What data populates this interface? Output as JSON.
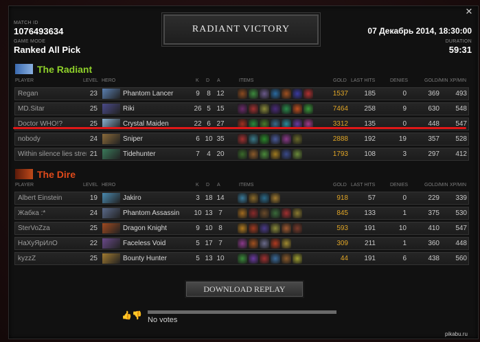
{
  "header": {
    "match_id_label": "MATCH ID",
    "match_id": "1076493634",
    "game_mode_label": "GAME MODE",
    "game_mode": "Ranked All Pick",
    "result_title": "RADIANT VICTORY",
    "date": "07 Декабрь 2014, 18:30:00",
    "duration_label": "DURATION",
    "duration": "59:31",
    "close_icon": "✕"
  },
  "columns": {
    "player": "PLAYER",
    "level": "LEVEL",
    "hero": "HERO",
    "k": "K",
    "d": "D",
    "a": "A",
    "items": "ITEMS",
    "gold": "GOLD",
    "last_hits": "LAST HITS",
    "denies": "DENIES",
    "gold_min": "GOLD/MIN",
    "xp_min": "XP/MIN"
  },
  "radiant": {
    "name": "The Radiant",
    "color": "#8fd12a",
    "players": [
      {
        "player": "Regan",
        "level": "23",
        "hero": "Phantom Lancer",
        "k": "9",
        "d": "8",
        "a": "12",
        "gold": "1537",
        "lh": "185",
        "den": "0",
        "gpm": "369",
        "xpm": "493",
        "hero_color": "#5a7fb0",
        "items": [
          "#8a4a20",
          "#3d8a3d",
          "#6a5a8a",
          "#2a6aa0",
          "#a05020",
          "#3a3aa0",
          "#b03030"
        ]
      },
      {
        "player": "MD.Sitar",
        "level": "25",
        "hero": "Riki",
        "k": "26",
        "d": "5",
        "a": "15",
        "gold": "7464",
        "lh": "258",
        "den": "9",
        "gpm": "630",
        "xpm": "548",
        "hero_color": "#4a4a8a",
        "items": [
          "#6a2a6a",
          "#a03030",
          "#8a8a3a",
          "#4a2a7a",
          "#2a8a4a",
          "#c05020",
          "#3a9a3a"
        ]
      },
      {
        "player": "Doctor WHO!?",
        "level": "25",
        "hero": "Crystal Maiden",
        "k": "22",
        "d": "6",
        "a": "27",
        "gold": "3312",
        "lh": "135",
        "den": "0",
        "gpm": "448",
        "xpm": "547",
        "hero_color": "#8ab0d0",
        "items": [
          "#a03020",
          "#2a8a3a",
          "#4a7a2a",
          "#3a6a8a",
          "#2a8a9a",
          "#6a3aa0",
          "#a03a8a"
        ]
      },
      {
        "player": "nobody",
        "level": "24",
        "hero": "Sniper",
        "k": "6",
        "d": "10",
        "a": "35",
        "gold": "2888",
        "lh": "192",
        "den": "19",
        "gpm": "357",
        "xpm": "528",
        "hero_color": "#8a6a3a",
        "items": [
          "#a03030",
          "#3a7a8a",
          "#2a8a2a",
          "#4a5a9a",
          "#8a3a8a",
          "#6a6a2a"
        ]
      },
      {
        "player": "Within silence lies strength",
        "level": "21",
        "hero": "Tidehunter",
        "k": "7",
        "d": "4",
        "a": "20",
        "gold": "1793",
        "lh": "108",
        "den": "3",
        "gpm": "297",
        "xpm": "412",
        "hero_color": "#3a7a5a",
        "items": [
          "#3a6a2a",
          "#8a5a2a",
          "#4a8a3a",
          "#a07a20",
          "#3a4a8a",
          "#6a8a3a"
        ]
      }
    ]
  },
  "dire": {
    "name": "The Dire",
    "color": "#e04a1a",
    "players": [
      {
        "player": "Albert Einstein",
        "level": "19",
        "hero": "Jakiro",
        "k": "3",
        "d": "18",
        "a": "14",
        "gold": "918",
        "lh": "57",
        "den": "0",
        "gpm": "229",
        "xpm": "339",
        "hero_color": "#4a8ab0",
        "items": [
          "#3a7a9a",
          "#8a6a2a",
          "#2a6a8a",
          "#a07a30"
        ]
      },
      {
        "player": "Жабка :*",
        "level": "24",
        "hero": "Phantom Assassin",
        "k": "10",
        "d": "13",
        "a": "7",
        "gold": "845",
        "lh": "133",
        "den": "1",
        "gpm": "375",
        "xpm": "530",
        "hero_color": "#5a6a8a",
        "items": [
          "#a06a20",
          "#8a2a2a",
          "#6a4a2a",
          "#3a6a3a",
          "#a03030",
          "#8a7a30"
        ]
      },
      {
        "player": "SterVoZza",
        "level": "25",
        "hero": "Dragon Knight",
        "k": "9",
        "d": "10",
        "a": "8",
        "gold": "593",
        "lh": "191",
        "den": "10",
        "gpm": "410",
        "xpm": "547",
        "hero_color": "#a04a20",
        "items": [
          "#b07a20",
          "#a03a20",
          "#4a3a8a",
          "#8a8a3a",
          "#a05a30",
          "#7a3a2a"
        ]
      },
      {
        "player": "НаХуЯрИлО",
        "level": "22",
        "hero": "Faceless Void",
        "k": "5",
        "d": "17",
        "a": "7",
        "gold": "309",
        "lh": "211",
        "den": "1",
        "gpm": "360",
        "xpm": "448",
        "hero_color": "#6a4a8a",
        "items": [
          "#8a3a8a",
          "#a05020",
          "#6a6a8a",
          "#b03a20",
          "#a08a30"
        ]
      },
      {
        "player": "kyzzZ",
        "level": "25",
        "hero": "Bounty Hunter",
        "k": "5",
        "d": "13",
        "a": "10",
        "gold": "44",
        "lh": "191",
        "den": "6",
        "gpm": "438",
        "xpm": "560",
        "hero_color": "#a07a30",
        "items": [
          "#3a8a3a",
          "#6a3aa0",
          "#a03030",
          "#3a6a9a",
          "#8a5a2a",
          "#a0a030"
        ]
      }
    ]
  },
  "footer": {
    "download_label": "DOWNLOAD REPLAY",
    "votes_text": "No votes",
    "thumbs_icons": "👍👎",
    "watermark": "pikabu.ru"
  }
}
